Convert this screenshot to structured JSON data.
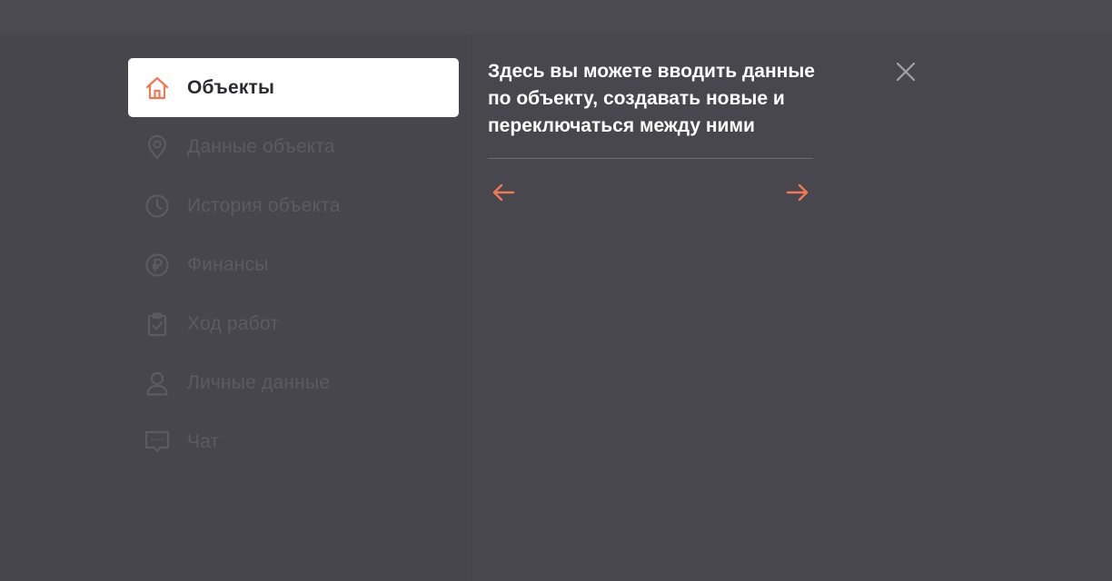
{
  "colors": {
    "accent": "#f07853",
    "muted_icon": "#5b5b61",
    "active_bg": "#ffffff",
    "overlay_bg": "#44444a"
  },
  "menu": {
    "items": [
      {
        "label": "Объекты",
        "icon": "home-icon",
        "active": true
      },
      {
        "label": "Данные объекта",
        "icon": "location-pin-icon",
        "active": false
      },
      {
        "label": "История объекта",
        "icon": "clock-icon",
        "active": false
      },
      {
        "label": "Финансы",
        "icon": "ruble-icon",
        "active": false
      },
      {
        "label": "Ход работ",
        "icon": "clipboard-check-icon",
        "active": false
      },
      {
        "label": "Личные данные",
        "icon": "user-icon",
        "active": false
      },
      {
        "label": "Чат",
        "icon": "chat-icon",
        "active": false
      }
    ]
  },
  "tooltip": {
    "text": "Здесь вы можете вводить данные по объекту, создавать новые и переключаться между ними",
    "prev_icon": "arrow-left-icon",
    "next_icon": "arrow-right-icon"
  },
  "close_icon": "close-icon"
}
